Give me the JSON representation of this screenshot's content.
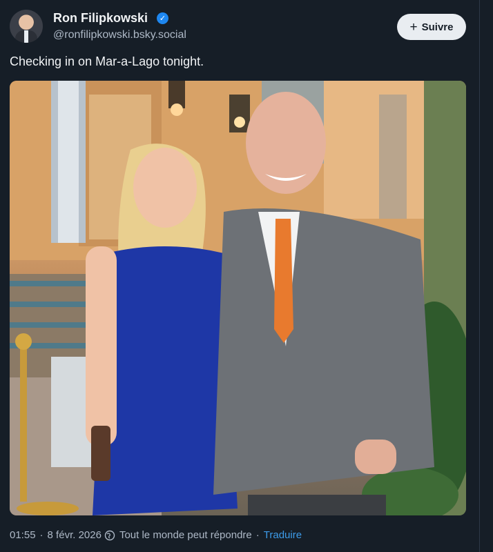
{
  "author": {
    "display_name": "Ron Filipkowski",
    "handle": "@ronfilipkowski.bsky.social",
    "verified": true
  },
  "follow_button": {
    "label": "Suivre",
    "icon": "plus-icon"
  },
  "post": {
    "text": "Checking in on Mar-a-Lago tonight."
  },
  "footer": {
    "time": "01:55",
    "date": "8 févr. 2026",
    "reply_setting": "Tout le monde peut répondre",
    "translate_label": "Traduire",
    "reply_icon": "globe-icon"
  },
  "colors": {
    "background": "#161e27",
    "accent": "#3d9be9",
    "verified": "#1e87f0",
    "button_bg": "#e9edf1"
  }
}
